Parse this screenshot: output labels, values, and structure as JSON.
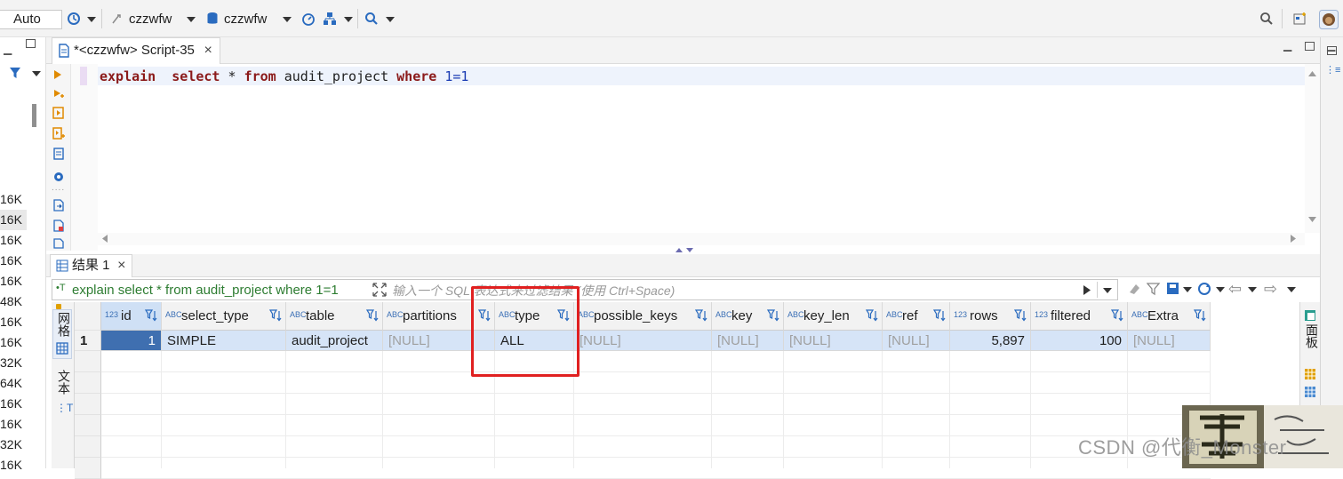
{
  "toolbar": {
    "mode_combo": "Auto",
    "connection": "czzwfw",
    "database": "czzwfw"
  },
  "left_sizes": [
    "16K",
    "16K",
    "16K",
    "16K",
    "16K",
    "48K",
    "16K",
    "16K",
    "32K",
    "64K",
    "16K",
    "16K",
    "32K",
    "16K"
  ],
  "editor": {
    "tab_title": "*<czzwfw> Script-35",
    "sql_keyword_explain": "explain",
    "sql_keyword_select": "select",
    "sql_star": "*",
    "sql_keyword_from": "from",
    "sql_table": "audit_project",
    "sql_keyword_where": "where",
    "sql_condition": "1=1"
  },
  "results": {
    "tab_title": "结果 1",
    "filter_query": "explain select * from audit_project where 1=1",
    "filter_placeholder": "输入一个 SQL 表达式来过滤结果 (使用 Ctrl+Space)",
    "side_label_grid": "网格",
    "side_label_text": "文本",
    "right_label_panel": "面板",
    "columns": [
      {
        "name": "id",
        "type": "123"
      },
      {
        "name": "select_type",
        "type": "ABC"
      },
      {
        "name": "table",
        "type": "ABC"
      },
      {
        "name": "partitions",
        "type": "ABC"
      },
      {
        "name": "type",
        "type": "ABC"
      },
      {
        "name": "possible_keys",
        "type": "ABC"
      },
      {
        "name": "key",
        "type": "ABC"
      },
      {
        "name": "key_len",
        "type": "ABC"
      },
      {
        "name": "ref",
        "type": "ABC"
      },
      {
        "name": "rows",
        "type": "123"
      },
      {
        "name": "filtered",
        "type": "123"
      },
      {
        "name": "Extra",
        "type": "ABC"
      }
    ],
    "rows": [
      {
        "row_number": "1",
        "id": "1",
        "select_type": "SIMPLE",
        "table": "audit_project",
        "partitions": "[NULL]",
        "type": "ALL",
        "possible_keys": "[NULL]",
        "key": "[NULL]",
        "key_len": "[NULL]",
        "ref": "[NULL]",
        "rows": "5,897",
        "filtered": "100",
        "Extra": "[NULL]"
      }
    ]
  },
  "highlight": {
    "color": "#e02020",
    "target_column": "type"
  },
  "watermark": {
    "text": "CSDN @代衡_Monster"
  },
  "colors": {
    "selected_row": "#d6e4f7",
    "keyword": "#8b1a1a",
    "number": "#1a3bb3",
    "filter_query": "#2e7d32"
  }
}
